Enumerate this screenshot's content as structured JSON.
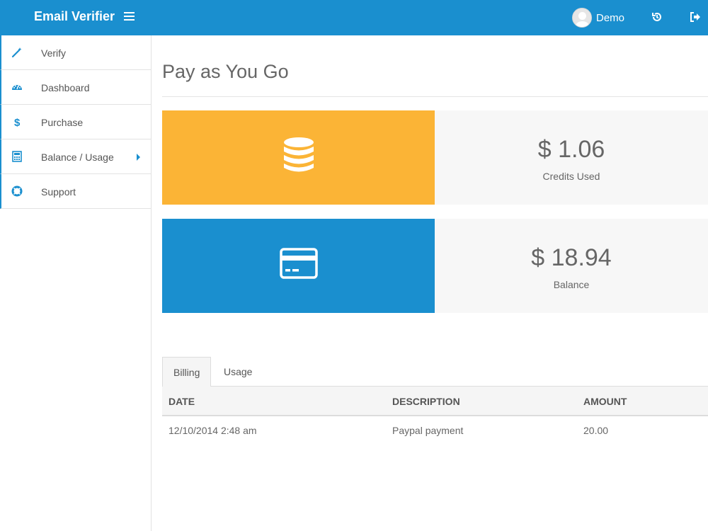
{
  "header": {
    "brand": "Email Verifier",
    "user_name": "Demo"
  },
  "sidebar": {
    "items": [
      {
        "label": "Verify",
        "icon": "magic-wand-icon"
      },
      {
        "label": "Dashboard",
        "icon": "dashboard-gauge-icon"
      },
      {
        "label": "Purchase",
        "icon": "dollar-icon"
      },
      {
        "label": "Balance / Usage",
        "icon": "calculator-icon",
        "has_submenu": true
      },
      {
        "label": "Support",
        "icon": "life-ring-icon"
      }
    ]
  },
  "main": {
    "title": "Pay as You Go",
    "stats": [
      {
        "value": "$ 1.06",
        "caption": "Credits Used",
        "icon": "database-icon",
        "color": "#fbb436"
      },
      {
        "value": "$ 18.94",
        "caption": "Balance",
        "icon": "credit-card-icon",
        "color": "#1a8fcf"
      }
    ],
    "tabs": [
      {
        "label": "Billing",
        "active": true
      },
      {
        "label": "Usage",
        "active": false
      }
    ],
    "table": {
      "columns": [
        "DATE",
        "DESCRIPTION",
        "AMOUNT"
      ],
      "rows": [
        [
          "12/10/2014 2:48 am",
          "Paypal payment",
          "20.00"
        ]
      ]
    }
  },
  "colors": {
    "primary": "#1a8fcf",
    "accent": "#fbb436"
  }
}
